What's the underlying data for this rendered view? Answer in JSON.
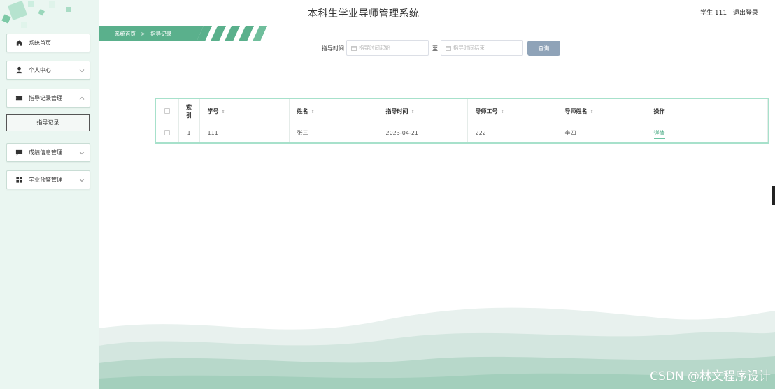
{
  "header": {
    "title": "本科生学业导师管理系统",
    "user_label": "学生 111",
    "logout_label": "退出登录"
  },
  "sidebar": {
    "items": [
      {
        "label": "系统首页",
        "icon": "home-icon"
      },
      {
        "label": "个人中心",
        "icon": "user-icon"
      },
      {
        "label": "指导记录管理",
        "icon": "ticket-icon"
      },
      {
        "label": "成绩信息管理",
        "icon": "message-icon"
      },
      {
        "label": "学业预警管理",
        "icon": "grid-icon"
      }
    ],
    "submenu": {
      "label": "指导记录"
    }
  },
  "breadcrumb": {
    "home": "系统首页",
    "separator": ">",
    "current": "指导记录"
  },
  "search": {
    "label": "指导时间",
    "start_placeholder": "指导时间起始",
    "end_placeholder": "指导时间结束",
    "separator": "至",
    "button_label": "查询"
  },
  "table": {
    "headers": {
      "index": "索引",
      "student_id": "学号",
      "name": "姓名",
      "guide_time": "指导时间",
      "tutor_id": "导师工号",
      "tutor_name": "导师姓名",
      "action": "操作"
    },
    "rows": [
      {
        "index": "1",
        "student_id": "111",
        "name": "张三",
        "guide_time": "2023-04-21",
        "tutor_id": "222",
        "tutor_name": "李四",
        "action": "详情"
      }
    ]
  },
  "watermark": "CSDN @林文程序设计",
  "colors": {
    "accent": "#3aa37a",
    "banner": "#5ab08c",
    "sidebar_bg": "#eaf6f1",
    "button": "#8fa3b8",
    "table_border": "#a7e1cb"
  }
}
